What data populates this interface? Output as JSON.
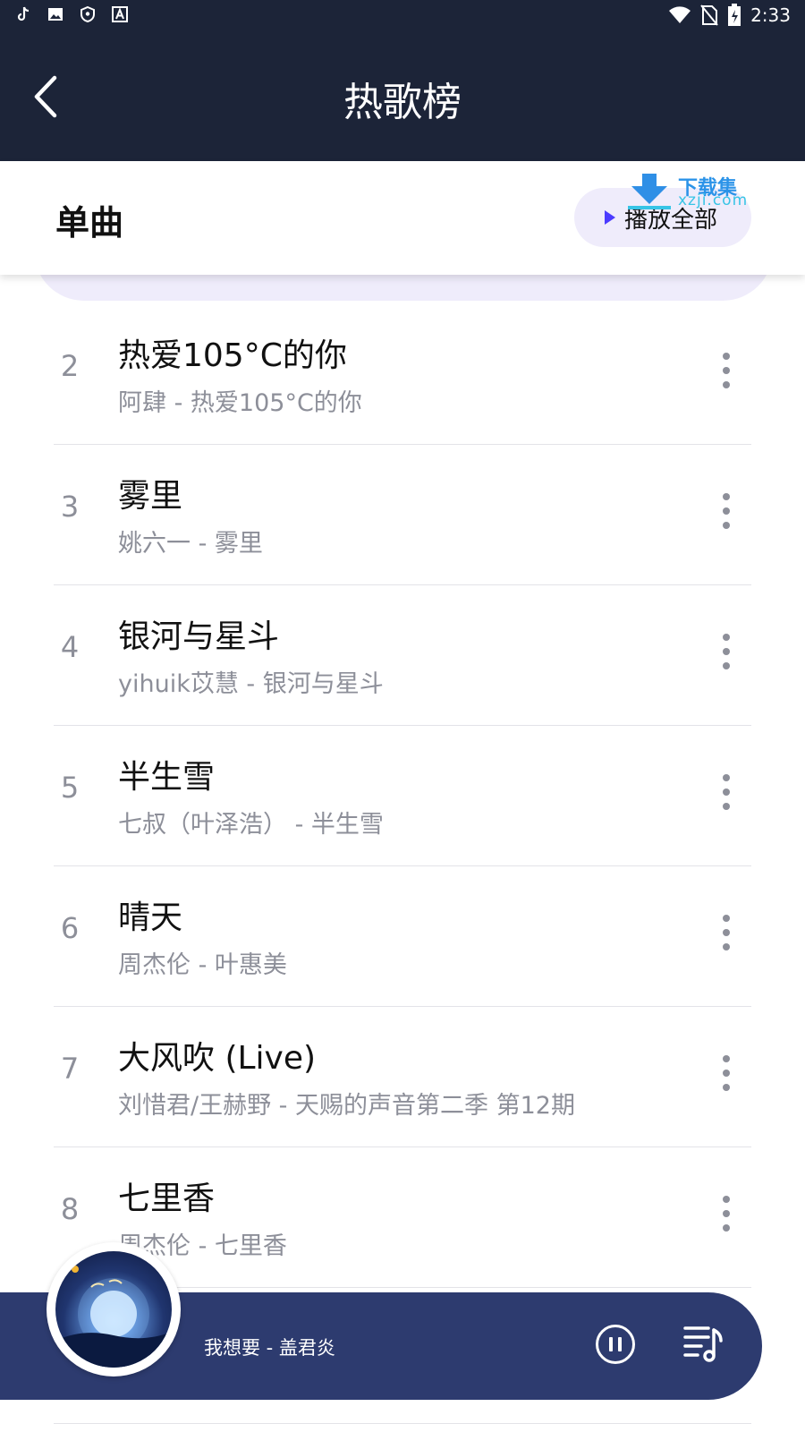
{
  "status_bar": {
    "time": "2:33",
    "icons": [
      "tiktok-icon",
      "image-icon",
      "shield-icon",
      "font-icon",
      "wifi-icon",
      "no-sim-icon",
      "battery-icon"
    ]
  },
  "header": {
    "title": "热歌榜",
    "back_icon": "chevron-left-icon",
    "background": "#1c2438"
  },
  "section": {
    "title": "单曲",
    "play_all_label": "播放全部",
    "play_icon": "play-icon",
    "accent": "#4b3bff"
  },
  "watermark": {
    "line1": "下载集",
    "line2": "xzji.com"
  },
  "songs": [
    {
      "rank": "2",
      "title": "热爱105°C的你",
      "subtitle": "阿肆 - 热爱105°C的你"
    },
    {
      "rank": "3",
      "title": "雾里",
      "subtitle": "姚六一 - 雾里"
    },
    {
      "rank": "4",
      "title": "银河与星斗",
      "subtitle": "yihuik苡慧 - 银河与星斗"
    },
    {
      "rank": "5",
      "title": "半生雪",
      "subtitle": "七叔（叶泽浩） - 半生雪"
    },
    {
      "rank": "6",
      "title": "晴天",
      "subtitle": "周杰伦 - 叶惠美"
    },
    {
      "rank": "7",
      "title": "大风吹 (Live)",
      "subtitle": "刘惜君/王赫野 - 天赐的声音第二季 第12期"
    },
    {
      "rank": "8",
      "title": "七里香",
      "subtitle": "周杰伦 - 七里香"
    }
  ],
  "player": {
    "now_playing": "我想要 - 盖君炎",
    "pause_icon": "pause-icon",
    "queue_icon": "playlist-icon",
    "background": "#2d3b6f"
  }
}
